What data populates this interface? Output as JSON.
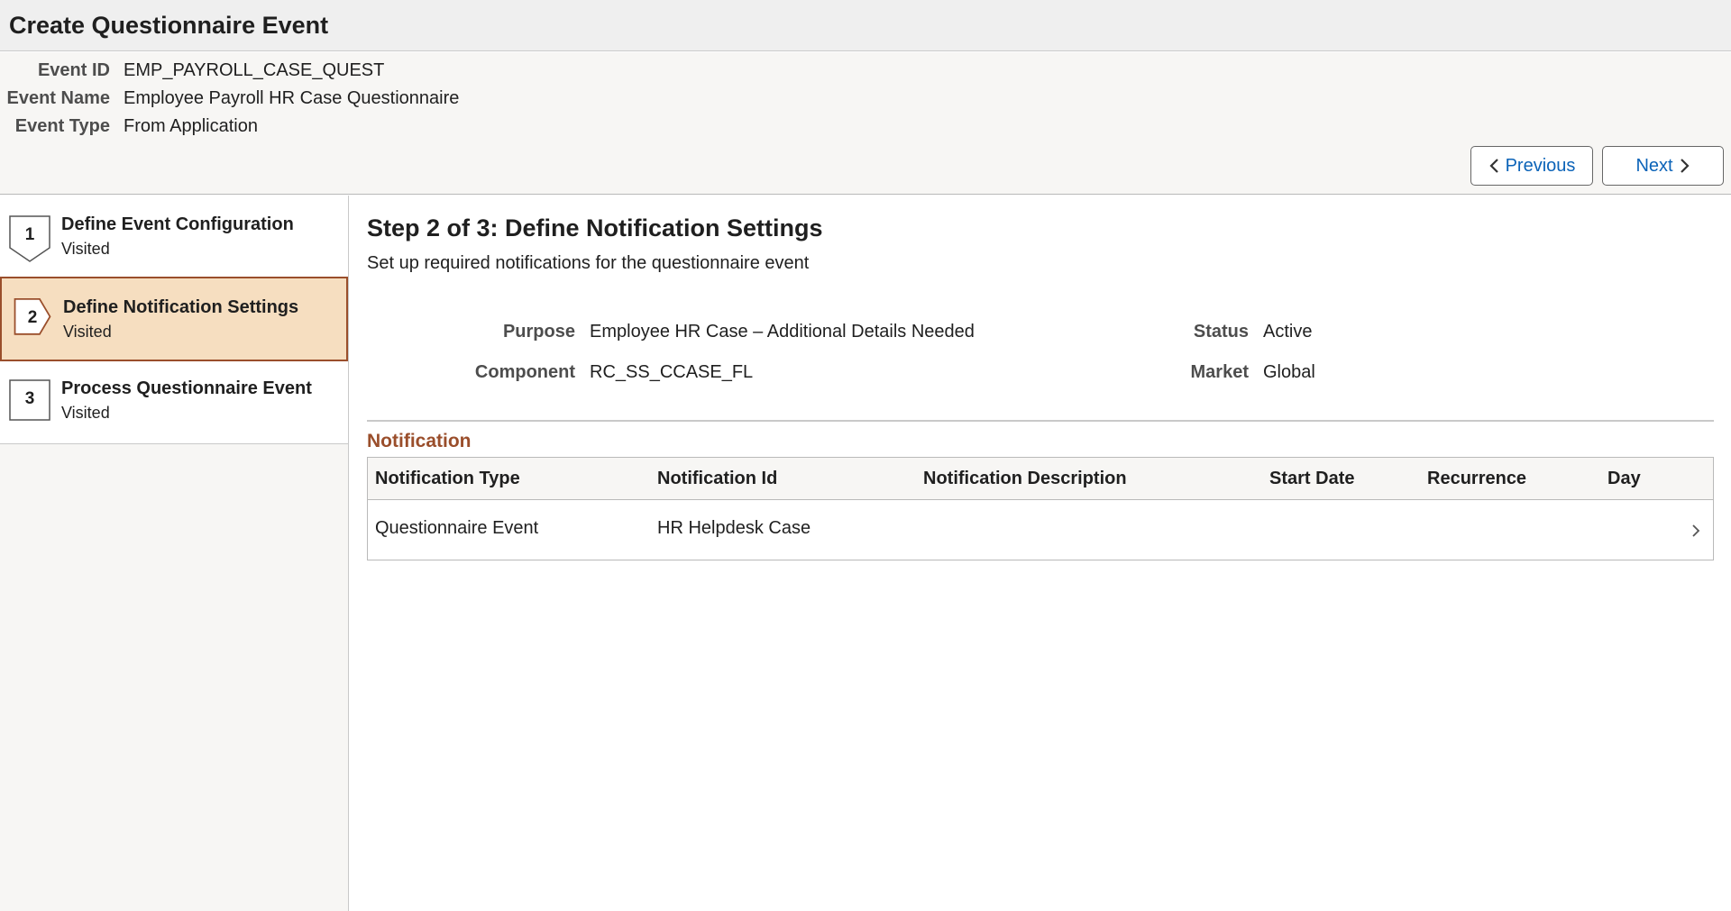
{
  "page": {
    "title": "Create Questionnaire Event"
  },
  "header": {
    "fields": [
      {
        "label": "Event ID",
        "value": "EMP_PAYROLL_CASE_QUEST"
      },
      {
        "label": "Event Name",
        "value": "Employee Payroll HR Case Questionnaire"
      },
      {
        "label": "Event Type",
        "value": "From Application"
      }
    ],
    "previous_label": "Previous",
    "next_label": "Next"
  },
  "steps": [
    {
      "number": "1",
      "title": "Define Event Configuration",
      "status": "Visited"
    },
    {
      "number": "2",
      "title": "Define Notification Settings",
      "status": "Visited",
      "active": true
    },
    {
      "number": "3",
      "title": "Process Questionnaire Event",
      "status": "Visited"
    }
  ],
  "main": {
    "heading": "Step 2 of 3: Define Notification Settings",
    "subtitle": "Set up required notifications for the questionnaire event",
    "details": {
      "purpose_label": "Purpose",
      "purpose_value": "Employee HR Case – Additional Details Needed",
      "status_label": "Status",
      "status_value": "Active",
      "component_label": "Component",
      "component_value": "RC_SS_CCASE_FL",
      "market_label": "Market",
      "market_value": "Global"
    },
    "notification": {
      "section_title": "Notification",
      "columns": [
        "Notification Type",
        "Notification Id",
        "Notification Description",
        "Start Date",
        "Recurrence",
        "Day"
      ],
      "rows": [
        {
          "type": "Questionnaire Event",
          "id": "HR Helpdesk Case",
          "description": "",
          "start_date": "",
          "recurrence": "",
          "day": ""
        }
      ]
    }
  },
  "colors": {
    "accent": "#9a4e2b",
    "active_step_bg": "#f6dec0",
    "link_blue": "#0b63b8"
  },
  "icons": {
    "previous": "chevron-left-icon",
    "next": "chevron-right-icon",
    "row_detail": "chevron-right-icon"
  }
}
